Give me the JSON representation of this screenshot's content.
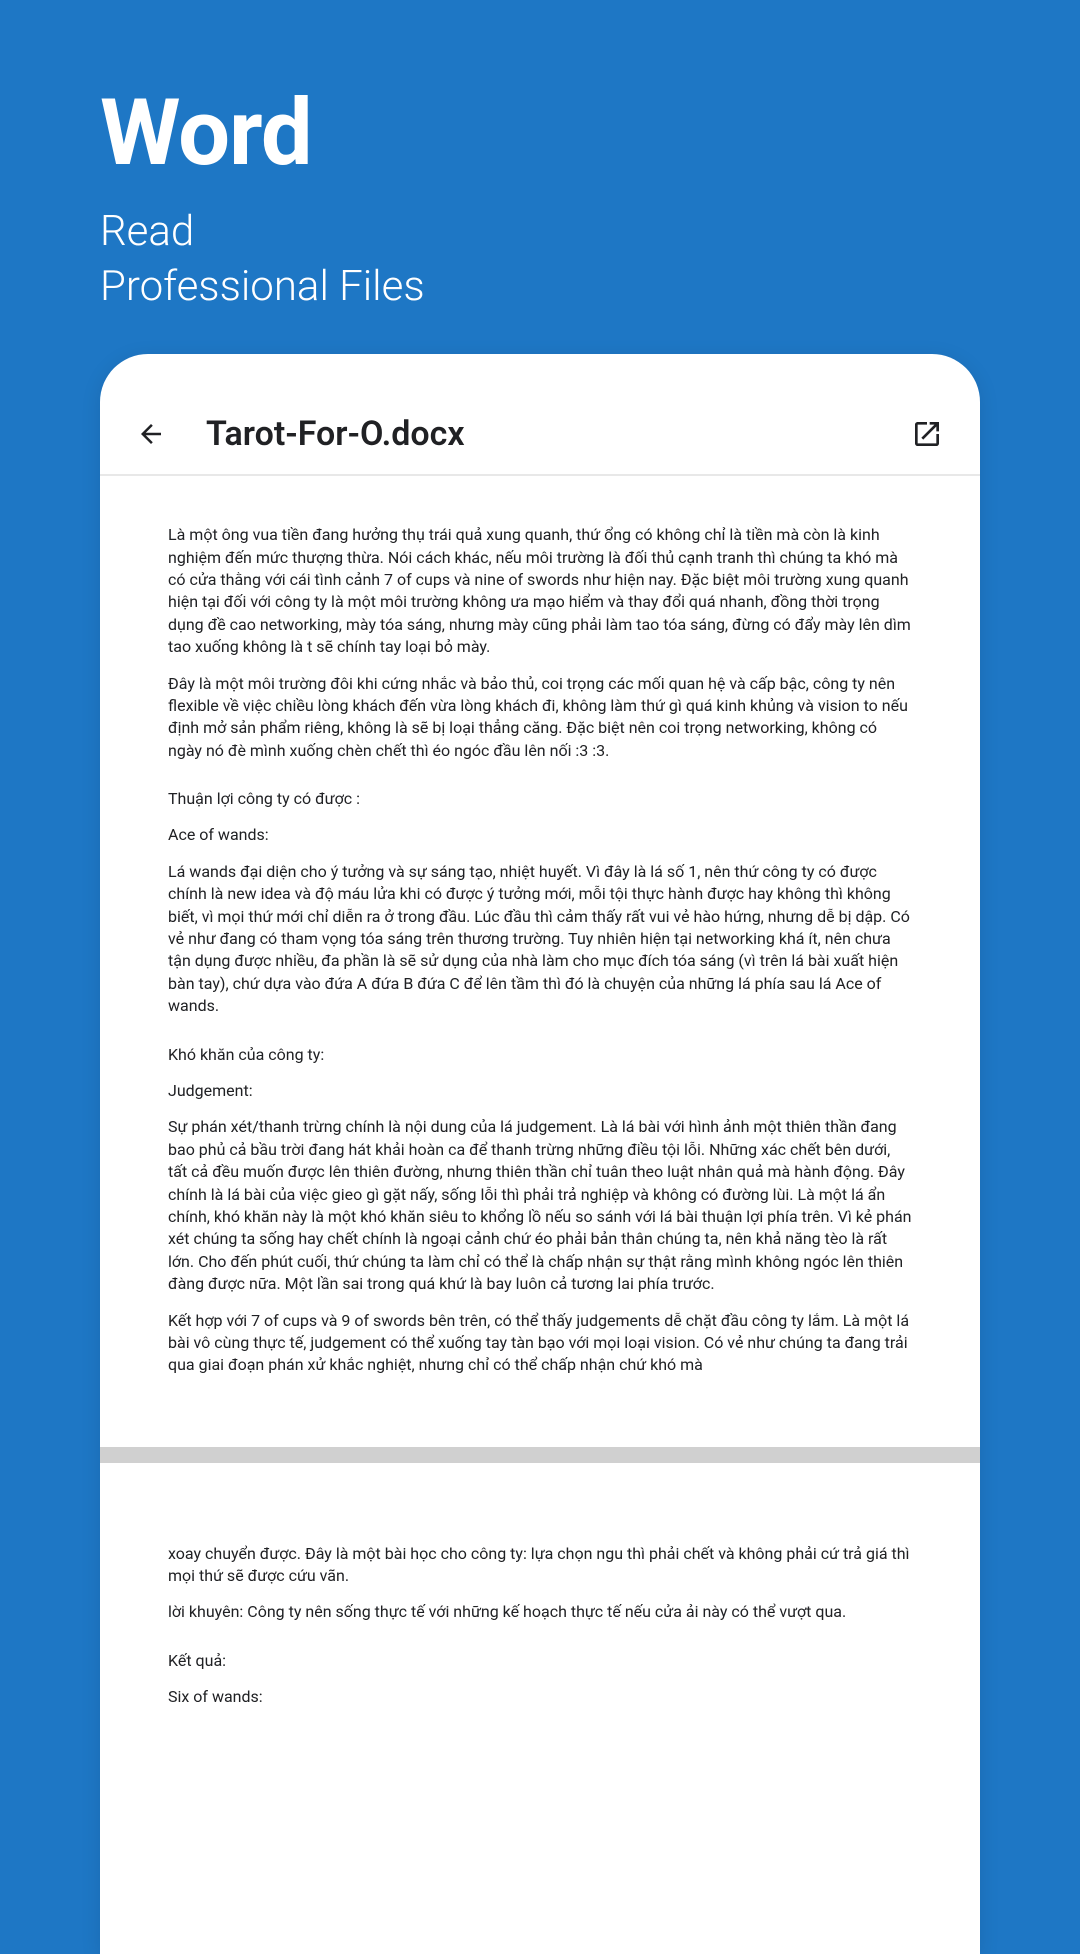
{
  "promo": {
    "title": "Word",
    "subtitle_line1": "Read",
    "subtitle_line2": "Professional Files"
  },
  "header": {
    "file_title": "Tarot-For-O.docx"
  },
  "document": {
    "p1": "Là một ông vua tiền đang hưởng thụ trái quả xung quanh, thứ ổng có không chỉ là tiền mà còn là kinh nghiệm đến mức thượng thừa. Nói cách khác, nếu môi trường là đối thủ cạnh tranh thì chúng ta khó mà có cửa thằng với cái tình cảnh 7 of cups và nine of swords như hiện nay. Đặc biệt môi trường xung quanh hiện tại đối với công ty là một môi trường không ưa mạo hiểm và thay đổi quá nhanh, đồng thời trọng dụng đề cao networking, mày tóa sáng, nhưng mày cũng phải làm tao tóa sáng, đừng có đẩy mày lên dìm tao xuống không là t sẽ chính tay loại bỏ mày.",
    "p2": "Đây là một môi trường đôi khi cứng nhắc và bảo thủ, coi trọng các mối quan hệ và cấp bậc, công ty nên flexible về việc chiều lòng khách đến vừa lòng khách đi, không làm thứ gì quá kinh khủng và vision to nếu định mở sản phẩm riêng, không là sẽ bị loại thẳng căng. Đặc biệt nên coi trọng networking, không có ngày nó đè mình xuống chèn chết thì éo ngóc đầu lên nối :3 :3.",
    "h1": "Thuận lợi công ty có được :",
    "h2": "Ace of wands:",
    "p3": "Lá wands đại diện cho ý tưởng và sự sáng tạo, nhiệt huyết. Vì đây là lá số 1, nên thứ công ty có được chính là new idea và độ máu lửa khi có được ý tưởng mới, mỗi tội thực hành được hay không thì không biết, vì mọi thứ mới chỉ diễn ra ở trong đầu. Lúc đầu thì cảm thấy rất vui vẻ hào hứng, nhưng dễ bị dập. Có vẻ như đang có tham vọng tóa sáng trên thương trường. Tuy nhiên hiện tại networking khá ít, nên chưa tận dụng được nhiều, đa phần là sẽ sử dụng của nhà làm cho mục đích tóa sáng (vì trên lá bài xuất hiện bàn tay), chứ dựa vào đứa A đứa B đứa C để lên tầm thì đó là chuyện của những lá phía sau lá Ace of wands.",
    "h3": "Khó khăn của công ty:",
    "h4": "Judgement:",
    "p4": "Sự phán xét/thanh trừng chính là nội dung của lá judgement. Là lá bài với hình ảnh một thiên thần đang bao phủ cả bầu trời đang hát khải hoàn ca để thanh trừng những điều tội lỗi. Những xác chết bên dưới, tất cả đều muốn được lên thiên đường, nhưng thiên thần chỉ tuân theo luật nhân quả mà hành động. Đây chính là lá bài của việc gieo gì gặt nấy, sống lỗi thì phải trả nghiệp và không có đường lùi. Là một lá ẩn chính, khó khăn này là một khó khăn siêu to khổng lồ nếu so sánh với lá bài thuận lợi phía trên. Vì kẻ phán xét chúng ta sống hay chết chính là ngoại cảnh chứ éo phải bản thân chúng ta, nên khả năng tèo là rất lớn. Cho đến phút cuối, thứ chúng ta làm chỉ có thể là chấp nhận sự thật rằng mình không ngóc lên thiên đàng được nữa. Một lần sai trong quá khứ là bay luôn cả tương lai phía trước.",
    "p5": "Kết hợp với 7 of cups và 9 of swords bên trên, có thể thấy judgements dễ chặt đầu công ty lắm. Là một lá bài vô cùng thực tế, judgement có thể xuống tay tàn bạo với mọi loại vision. Có vẻ như chúng ta đang trải qua giai đoạn phán xử khắc nghiệt, nhưng chỉ có thể chấp nhận chứ khó mà",
    "p6": "xoay chuyển được. Đây là một bài học cho công ty: lựa chọn ngu thì phải chết và không phải cứ trả giá thì mọi thứ sẽ được cứu vãn.",
    "p7": " lời khuyên: Công ty nên sống thực tế với những kế hoạch thực tế nếu cửa ải này có thể vượt qua.",
    "h5": "Kết quả:",
    "h6": "Six of wands:"
  }
}
